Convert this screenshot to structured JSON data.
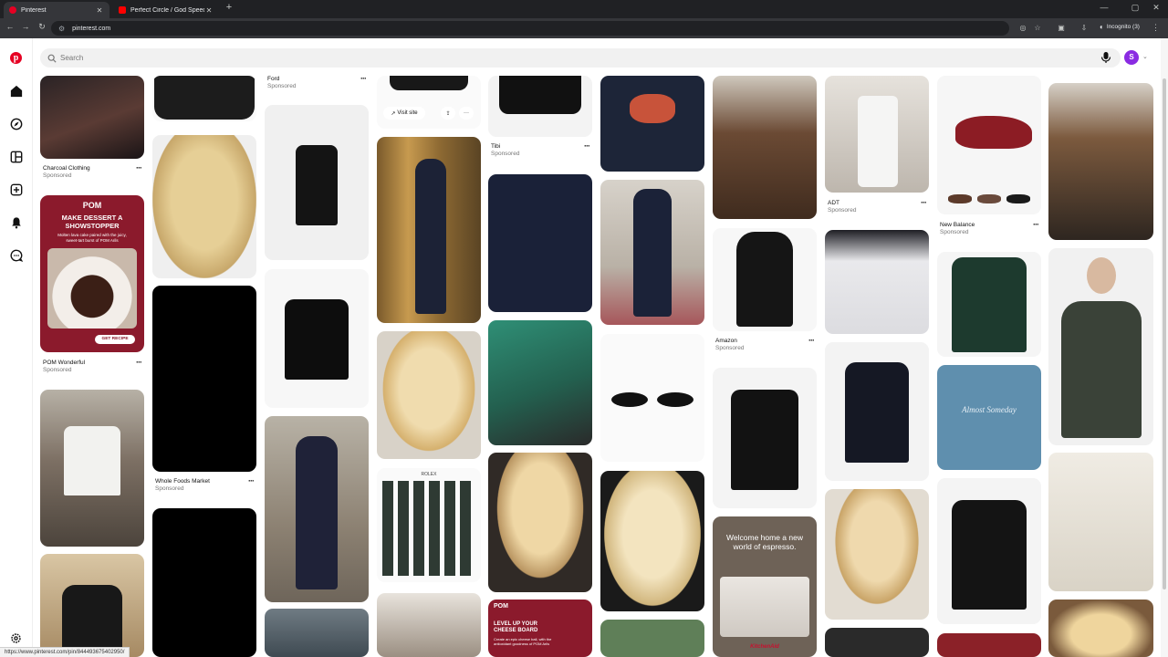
{
  "browser": {
    "tabs": [
      {
        "title": "Pinterest",
        "active": true,
        "favicon_color": "#e60023"
      },
      {
        "title": "Perfect Circle / God Speed - Yo",
        "active": false,
        "favicon_color": "#ff0000"
      }
    ],
    "url": "pinterest.com",
    "incognito_label": "Incognito (3)",
    "status_url": "https://www.pinterest.com/pin/844493675402950/"
  },
  "pinterest": {
    "brand_color": "#e60023",
    "search_placeholder": "Search",
    "avatar_initial": "S",
    "nav_icons": [
      "home-icon",
      "explore-icon",
      "boards-icon",
      "create-icon",
      "notifications-icon",
      "messages-icon",
      "settings-icon"
    ]
  },
  "pins": {
    "labels": {
      "ford": "Ford",
      "charcoal": "Charcoal Clothing",
      "pom": "POM Wonderful",
      "wholefoods": "Whole Foods Market",
      "tibi": "Tibi",
      "amazon": "Amazon",
      "adt": "ADT",
      "newbalance": "New Balance",
      "sponsored": "Sponsored",
      "visit_site": "Visit site"
    },
    "ad_text": {
      "pom_logo": "POM",
      "pom_headline": "MAKE DESSERT A SHOWSTOPPER",
      "pom_body": "Molten lava cake paired with the juicy, sweet-tart burst of POM Arils",
      "pom_cta": "GET RECIPE",
      "espresso_headline": "Welcome home a new world of espresso.",
      "espresso_brand": "KitchenAid",
      "pom2_logo": "POM",
      "pom2_headline": "LEVEL UP YOUR CHEESE BOARD",
      "pom2_body": "Create an epic cheese ball, with the antioxidant goodness of POM Arils",
      "watch_brand": "ROLEX",
      "sweatshirt_script": "Almost Someday"
    }
  }
}
